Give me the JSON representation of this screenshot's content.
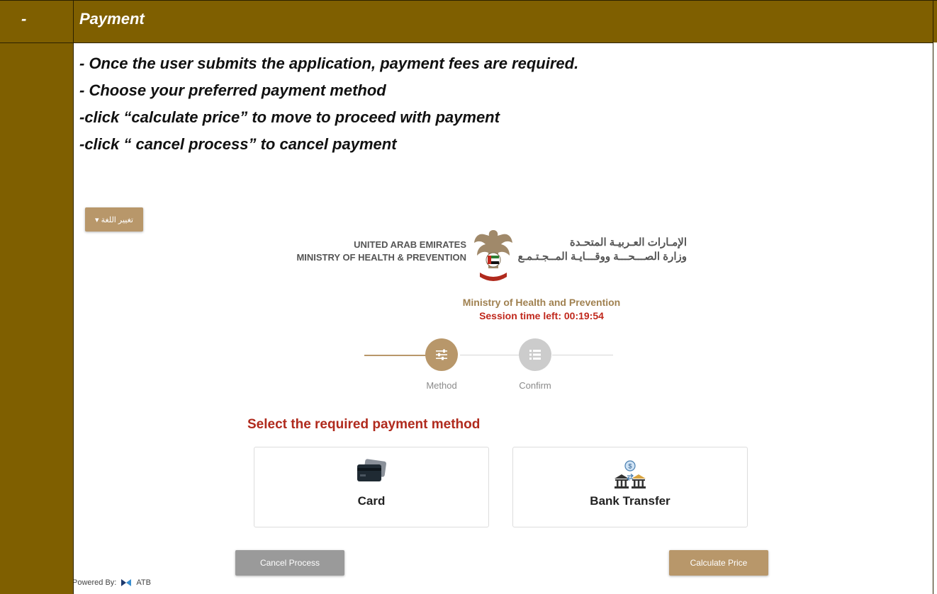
{
  "header": {
    "dash": "-",
    "title": "Payment"
  },
  "instructions": [
    "- Once the user submits the application, payment fees are required.",
    "- Choose your preferred payment method",
    "-click “calculate price” to move to proceed with payment",
    "-click “ cancel process” to cancel payment"
  ],
  "screen": {
    "language_button": "▾ تغيير اللغة",
    "logo": {
      "en_line1": "UNITED ARAB EMIRATES",
      "en_line2": "MINISTRY OF HEALTH & PREVENTION",
      "ar_line1": "الإمـارات العـربيـة المتحـدة",
      "ar_line2": "وزارة الصـــحـــة ووقـــايـة المــجـتـمـع"
    },
    "ministry_name": "Ministry of Health and Prevention",
    "session_time": "Session time left: 00:19:54",
    "steps": [
      {
        "label": "Method",
        "icon": "sliders-icon",
        "active": true
      },
      {
        "label": "Confirm",
        "icon": "list-icon",
        "active": false
      }
    ],
    "select_title": "Select the required payment method",
    "methods": [
      {
        "label": "Card",
        "icon": "credit-card-icon"
      },
      {
        "label": "Bank Transfer",
        "icon": "bank-transfer-icon"
      }
    ],
    "cancel_button": "Cancel Process",
    "calculate_button": "Calculate Price",
    "powered_by": "Powered By:",
    "powered_brand": "ATB"
  },
  "colors": {
    "brown": "#7f5f00",
    "gold": "#b8976a",
    "red": "#c0281c",
    "grey_button": "#9a9a9a"
  }
}
